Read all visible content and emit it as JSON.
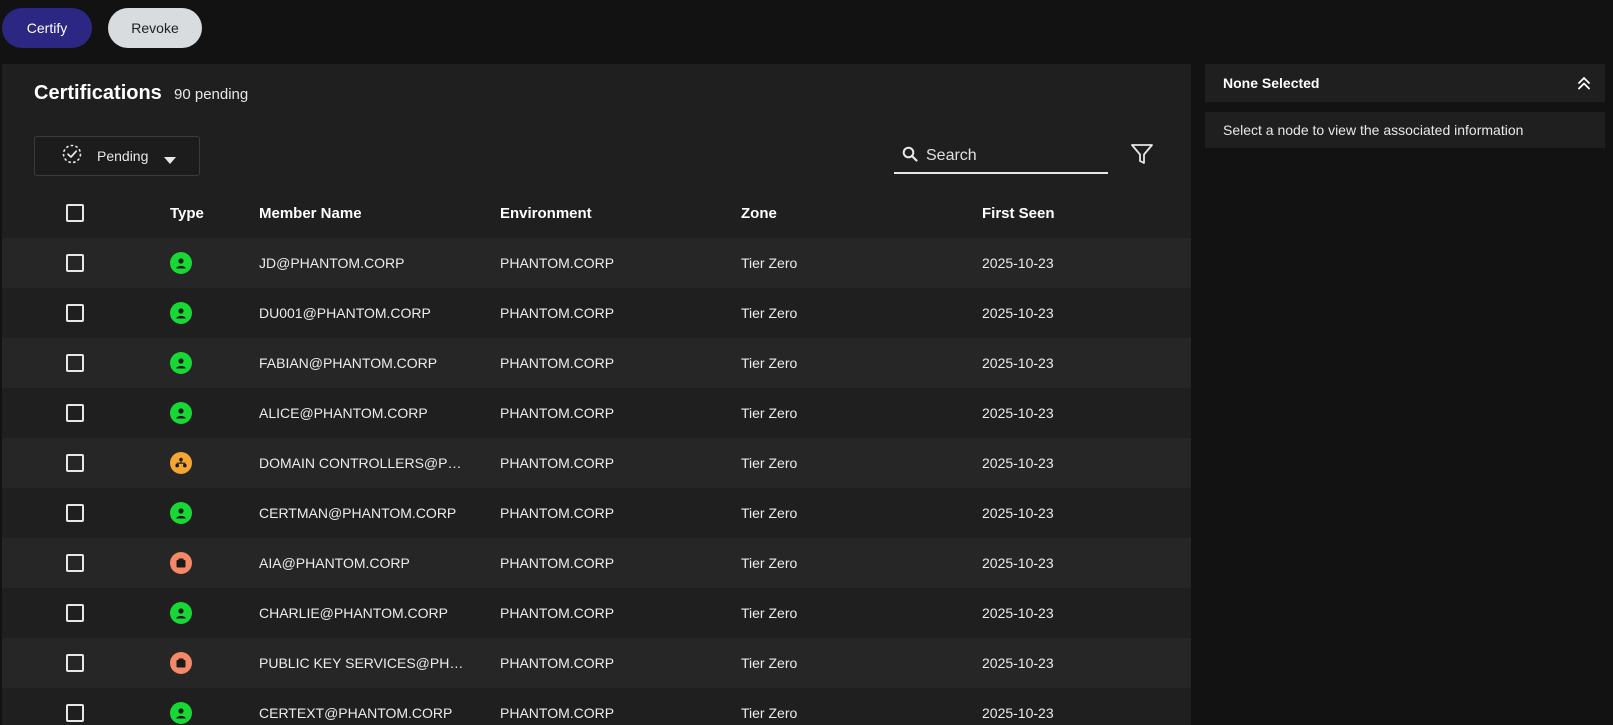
{
  "toolbar": {
    "certify_label": "Certify",
    "revoke_label": "Revoke"
  },
  "main": {
    "title": "Certifications",
    "pending_count": "90 pending",
    "status_filter": {
      "selected": "Pending"
    },
    "search": {
      "placeholder": "Search"
    },
    "columns": [
      "Type",
      "Member Name",
      "Environment",
      "Zone",
      "First Seen"
    ],
    "rows": [
      {
        "type": "user",
        "name": "JD@PHANTOM.CORP",
        "env": "PHANTOM.CORP",
        "zone": "Tier Zero",
        "seen": "2025-10-23"
      },
      {
        "type": "user",
        "name": "DU001@PHANTOM.CORP",
        "env": "PHANTOM.CORP",
        "zone": "Tier Zero",
        "seen": "2025-10-23"
      },
      {
        "type": "user",
        "name": "FABIAN@PHANTOM.CORP",
        "env": "PHANTOM.CORP",
        "zone": "Tier Zero",
        "seen": "2025-10-23"
      },
      {
        "type": "user",
        "name": "ALICE@PHANTOM.CORP",
        "env": "PHANTOM.CORP",
        "zone": "Tier Zero",
        "seen": "2025-10-23"
      },
      {
        "type": "group",
        "name": "DOMAIN CONTROLLERS@P…",
        "env": "PHANTOM.CORP",
        "zone": "Tier Zero",
        "seen": "2025-10-23"
      },
      {
        "type": "user",
        "name": "CERTMAN@PHANTOM.CORP",
        "env": "PHANTOM.CORP",
        "zone": "Tier Zero",
        "seen": "2025-10-23"
      },
      {
        "type": "container",
        "name": "AIA@PHANTOM.CORP",
        "env": "PHANTOM.CORP",
        "zone": "Tier Zero",
        "seen": "2025-10-23"
      },
      {
        "type": "user",
        "name": "CHARLIE@PHANTOM.CORP",
        "env": "PHANTOM.CORP",
        "zone": "Tier Zero",
        "seen": "2025-10-23"
      },
      {
        "type": "container",
        "name": "PUBLIC KEY SERVICES@PH…",
        "env": "PHANTOM.CORP",
        "zone": "Tier Zero",
        "seen": "2025-10-23"
      },
      {
        "type": "user",
        "name": "CERTEXT@PHANTOM.CORP",
        "env": "PHANTOM.CORP",
        "zone": "Tier Zero",
        "seen": "2025-10-23"
      }
    ]
  },
  "side_panel": {
    "header": "None Selected",
    "body": "Select a node to view the associated information"
  },
  "colors": {
    "user": "#17d835",
    "group": "#f5a531",
    "container": "#f58866",
    "certify": "#2b2783"
  }
}
